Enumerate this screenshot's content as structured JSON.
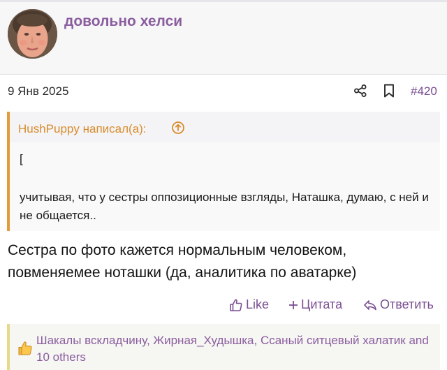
{
  "post": {
    "username": "довольно хелси",
    "date": "9 Янв 2025",
    "number": "#420",
    "accent_color": "#7a4f92",
    "quote_color": "#e39a3b"
  },
  "quote": {
    "author": "HushPuppy написал(а):",
    "bracket": "[",
    "text": "учитывая, что у сестры оппозиционные взгляды, Наташка, думаю, с ней и не общается.."
  },
  "message": {
    "text": "Сестра по фото кажется нормальным человеком, повменяемее ноташки (да, аналитика по аватарке)"
  },
  "actions": {
    "like": "Like",
    "quote": "Цитата",
    "reply": "Ответить"
  },
  "reactions": {
    "text": "Шакалы вскладчину, Жирная_Худышка, Ссаный ситцевый халатик and 10 others",
    "icon": "thumbs-up-emoji"
  }
}
